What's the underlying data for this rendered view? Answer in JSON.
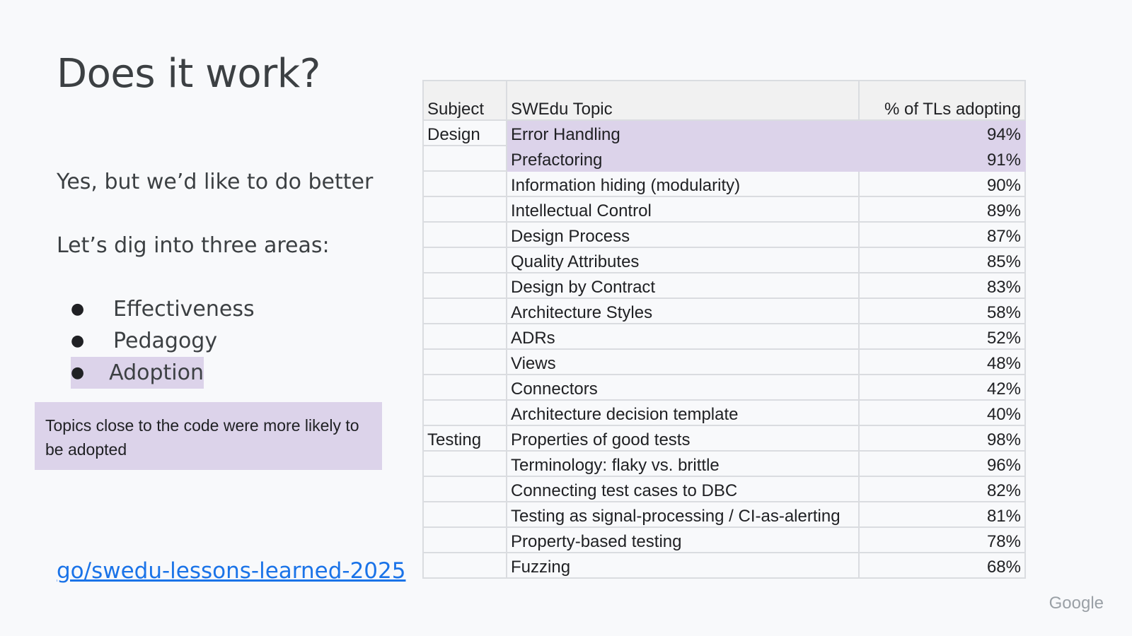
{
  "slide": {
    "title": "Does it work?",
    "subtitle": "Yes, but we’d like to do better",
    "lead": "Let’s dig into three areas:",
    "bullets": [
      {
        "marker": "●",
        "label": "Effectiveness"
      },
      {
        "marker": "●",
        "label": "Pedagogy"
      },
      {
        "marker": "●",
        "label": "Adoption"
      }
    ],
    "callout": "Topics close to the code were more likely to be adopted",
    "link": "go/swedu-lessons-learned-2025",
    "brand": "Google",
    "highlight_color": "#dcd3ea",
    "link_color": "#1a73e8"
  },
  "table": {
    "headers": [
      "Subject",
      "SWEdu Topic",
      "% of TLs adopting"
    ],
    "rows": [
      {
        "subject": "Design",
        "topic": "Error Handling",
        "pct": "94%"
      },
      {
        "subject": "",
        "topic": "Prefactoring",
        "pct": "91%"
      },
      {
        "subject": "",
        "topic": "Information hiding (modularity)",
        "pct": "90%"
      },
      {
        "subject": "",
        "topic": "Intellectual Control",
        "pct": "89%"
      },
      {
        "subject": "",
        "topic": "Design Process",
        "pct": "87%"
      },
      {
        "subject": "",
        "topic": "Quality Attributes",
        "pct": "85%"
      },
      {
        "subject": "",
        "topic": "Design by Contract",
        "pct": "83%"
      },
      {
        "subject": "",
        "topic": "Architecture Styles",
        "pct": "58%"
      },
      {
        "subject": "",
        "topic": "ADRs",
        "pct": "52%"
      },
      {
        "subject": "",
        "topic": "Views",
        "pct": "48%"
      },
      {
        "subject": "",
        "topic": "Connectors",
        "pct": "42%"
      },
      {
        "subject": "",
        "topic": "Architecture decision template",
        "pct": "40%"
      },
      {
        "subject": "Testing",
        "topic": "Properties of good tests",
        "pct": "98%"
      },
      {
        "subject": "",
        "topic": "Terminology: flaky vs. brittle",
        "pct": "96%"
      },
      {
        "subject": "",
        "topic": "Connecting test cases to DBC",
        "pct": "82%"
      },
      {
        "subject": "",
        "topic": "Testing as signal-processing / CI-as-alerting",
        "pct": "81%"
      },
      {
        "subject": "",
        "topic": "Property-based testing",
        "pct": "78%"
      },
      {
        "subject": "",
        "topic": "Fuzzing",
        "pct": "68%"
      }
    ]
  }
}
